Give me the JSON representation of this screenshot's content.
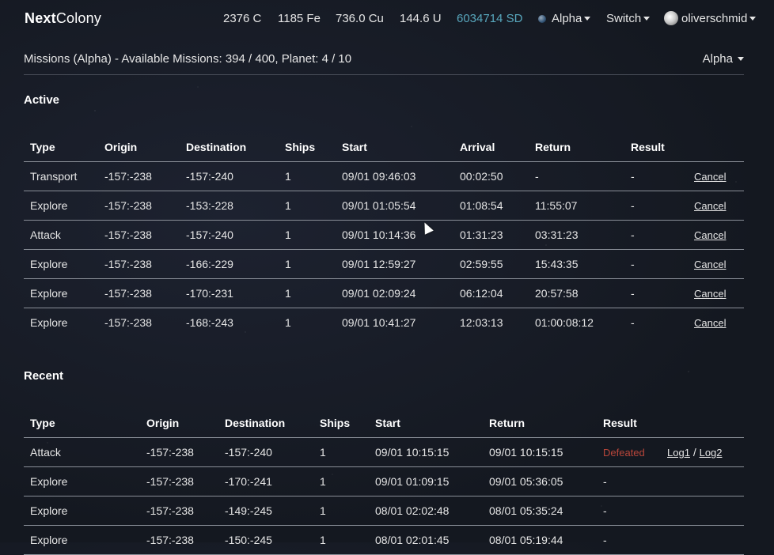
{
  "brand": {
    "bold": "Next",
    "rest": "Colony"
  },
  "resources": {
    "coal": "2376 C",
    "iron": "1185 Fe",
    "copper": "736.0 Cu",
    "uranium": "144.6 U",
    "stardust": "6034714 SD"
  },
  "nav": {
    "planet": "Alpha",
    "switch": "Switch",
    "user": "oliverschmid"
  },
  "colors": {
    "stardust": "#58a7bd",
    "defeated": "#b9463a",
    "divider": "#8a8f98"
  },
  "missions": {
    "title": "Missions (Alpha) - Available Missions: 394 / 400, Planet: 4 / 10",
    "planet_select": "Alpha"
  },
  "active": {
    "title": "Active",
    "columns": [
      "Type",
      "Origin",
      "Destination",
      "Ships",
      "Start",
      "Arrival",
      "Return",
      "Result"
    ],
    "rows": [
      {
        "type": "Transport",
        "origin": "-157:-238",
        "destination": "-157:-240",
        "ships": "1",
        "start": "09/01 09:46:03",
        "arrival": "00:02:50",
        "return": "-",
        "result": "-",
        "action": "Cancel"
      },
      {
        "type": "Explore",
        "origin": "-157:-238",
        "destination": "-153:-228",
        "ships": "1",
        "start": "09/01 01:05:54",
        "arrival": "01:08:54",
        "return": "11:55:07",
        "result": "-",
        "action": "Cancel"
      },
      {
        "type": "Attack",
        "origin": "-157:-238",
        "destination": "-157:-240",
        "ships": "1",
        "start": "09/01 10:14:36",
        "arrival": "01:31:23",
        "return": "03:31:23",
        "result": "-",
        "action": "Cancel"
      },
      {
        "type": "Explore",
        "origin": "-157:-238",
        "destination": "-166:-229",
        "ships": "1",
        "start": "09/01 12:59:27",
        "arrival": "02:59:55",
        "return": "15:43:35",
        "result": "-",
        "action": "Cancel"
      },
      {
        "type": "Explore",
        "origin": "-157:-238",
        "destination": "-170:-231",
        "ships": "1",
        "start": "09/01 02:09:24",
        "arrival": "06:12:04",
        "return": "20:57:58",
        "result": "-",
        "action": "Cancel"
      },
      {
        "type": "Explore",
        "origin": "-157:-238",
        "destination": "-168:-243",
        "ships": "1",
        "start": "09/01 10:41:27",
        "arrival": "12:03:13",
        "return": "01:00:08:12",
        "result": "-",
        "action": "Cancel"
      }
    ]
  },
  "recent": {
    "title": "Recent",
    "columns": [
      "Type",
      "Origin",
      "Destination",
      "Ships",
      "Start",
      "Return",
      "Result"
    ],
    "rows": [
      {
        "type": "Attack",
        "origin": "-157:-238",
        "destination": "-157:-240",
        "ships": "1",
        "start": "09/01 10:15:15",
        "return": "09/01 10:15:15",
        "result": "Defeated",
        "log1": "Log1",
        "sep": "/",
        "log2": "Log2"
      },
      {
        "type": "Explore",
        "origin": "-157:-238",
        "destination": "-170:-241",
        "ships": "1",
        "start": "09/01 01:09:15",
        "return": "09/01 05:36:05",
        "result": "-"
      },
      {
        "type": "Explore",
        "origin": "-157:-238",
        "destination": "-149:-245",
        "ships": "1",
        "start": "08/01 02:02:48",
        "return": "08/01 05:35:24",
        "result": "-"
      },
      {
        "type": "Explore",
        "origin": "-157:-238",
        "destination": "-150:-245",
        "ships": "1",
        "start": "08/01 02:01:45",
        "return": "08/01 05:19:44",
        "result": "-"
      }
    ]
  }
}
